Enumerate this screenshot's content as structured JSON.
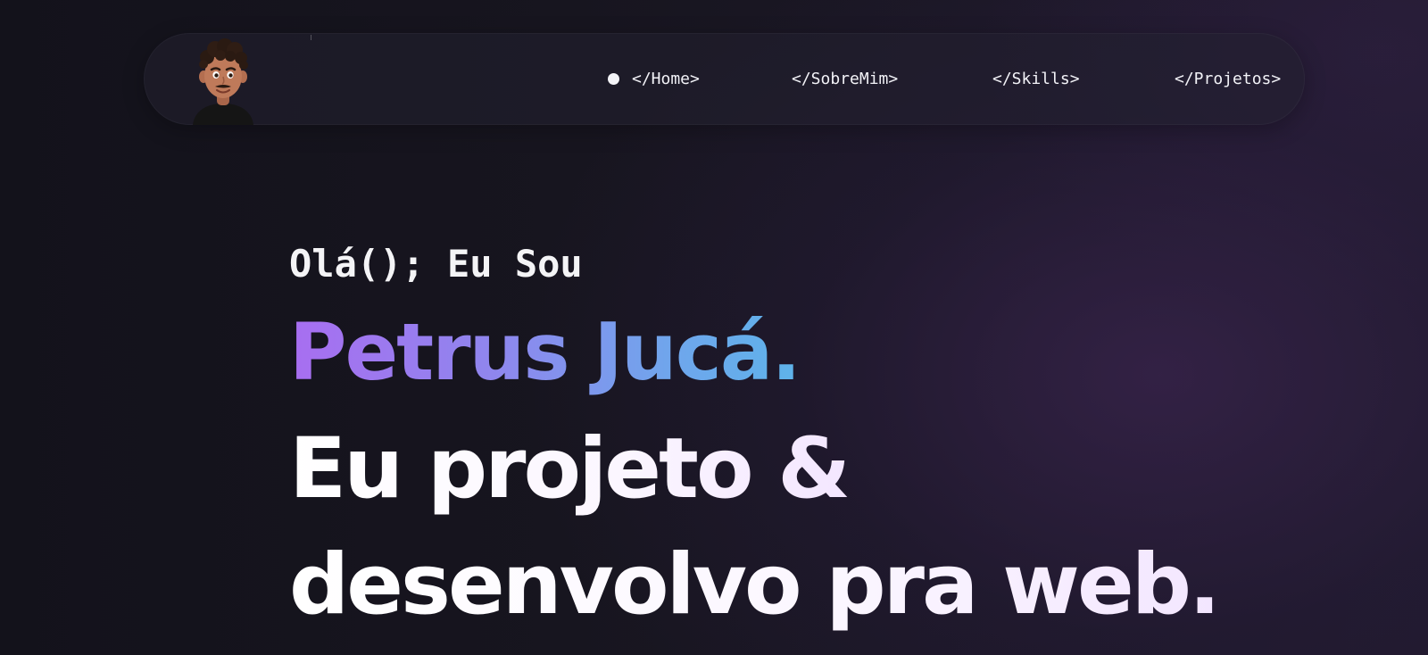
{
  "nav": {
    "avatar_alt": "avatar",
    "items": [
      {
        "label": "</Home>",
        "active": true
      },
      {
        "label": "</SobreMim>",
        "active": false
      },
      {
        "label": "</Skills>",
        "active": false
      },
      {
        "label": "</Projetos>",
        "active": false
      }
    ]
  },
  "hero": {
    "greeting": "Olá(); Eu Sou",
    "name": "Petrus Jucá.",
    "headline_line1": "Eu projeto &",
    "headline_line2": "desenvolvo pra web."
  },
  "colors": {
    "background": "#15141f",
    "name_gradient_start": "#a86ef0",
    "name_gradient_end": "#5eb3ea",
    "text": "#ffffff"
  }
}
